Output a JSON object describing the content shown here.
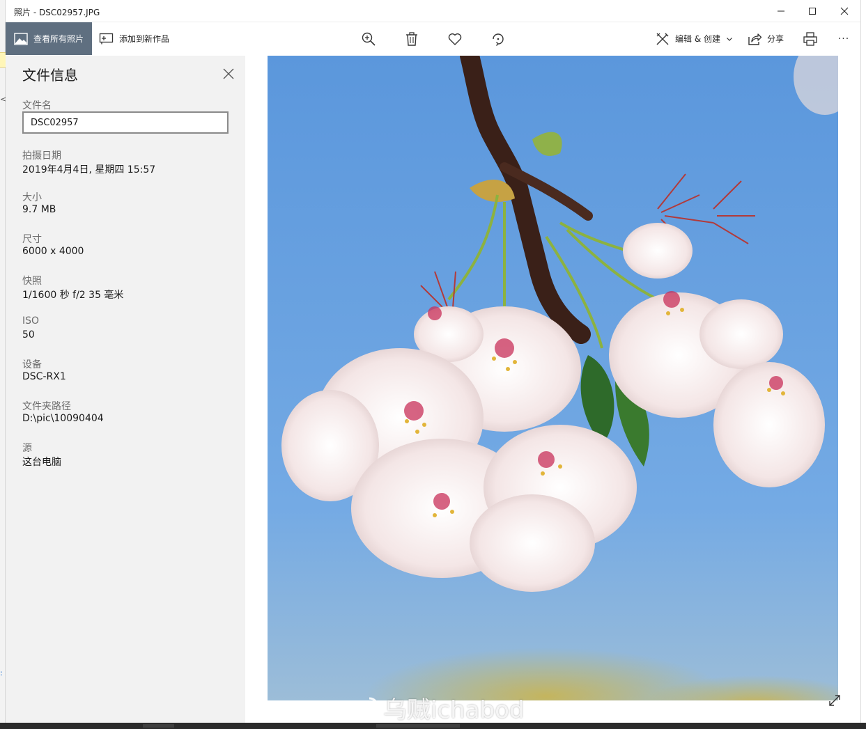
{
  "window": {
    "title": "照片 - DSC02957.JPG"
  },
  "toolbar": {
    "view_all_label": "查看所有照片",
    "add_to_creation_label": "添加到新作品",
    "edit_create_label": "编辑 & 创建",
    "share_label": "分享",
    "more_label": "···"
  },
  "panel": {
    "title": "文件信息",
    "fields": [
      {
        "label": "文件名",
        "value": "DSC02957"
      },
      {
        "label": "拍摄日期",
        "value": "2019年4月4日, 星期四 15:57"
      },
      {
        "label": "大小",
        "value": "9.7 MB"
      },
      {
        "label": "尺寸",
        "value": "6000 x 4000"
      },
      {
        "label": "快照",
        "value": "1/1600 秒 f/2 35 毫米"
      },
      {
        "label": "ISO",
        "value": "50"
      },
      {
        "label": "设备",
        "value": "DSC-RX1"
      },
      {
        "label": "文件夹路径",
        "value": "D:\\pic\\10090404"
      },
      {
        "label": "源",
        "value": "这台电脑"
      }
    ]
  },
  "watermark": {
    "text": "乌贼ichabod"
  },
  "colors": {
    "accent_view_all": "#5f6f80",
    "panel_bg": "#f2f2f2",
    "sky_blue": "#6aa2e0"
  },
  "icons": [
    "image-icon",
    "add-creation-icon",
    "zoom-in-icon",
    "delete-icon",
    "favorite-heart-icon",
    "rotate-icon",
    "edit-create-icon",
    "chevron-down-icon",
    "share-icon",
    "print-icon",
    "more-icon",
    "close-icon",
    "expand-icon",
    "minimize-icon",
    "maximize-icon",
    "weibo-icon"
  ]
}
